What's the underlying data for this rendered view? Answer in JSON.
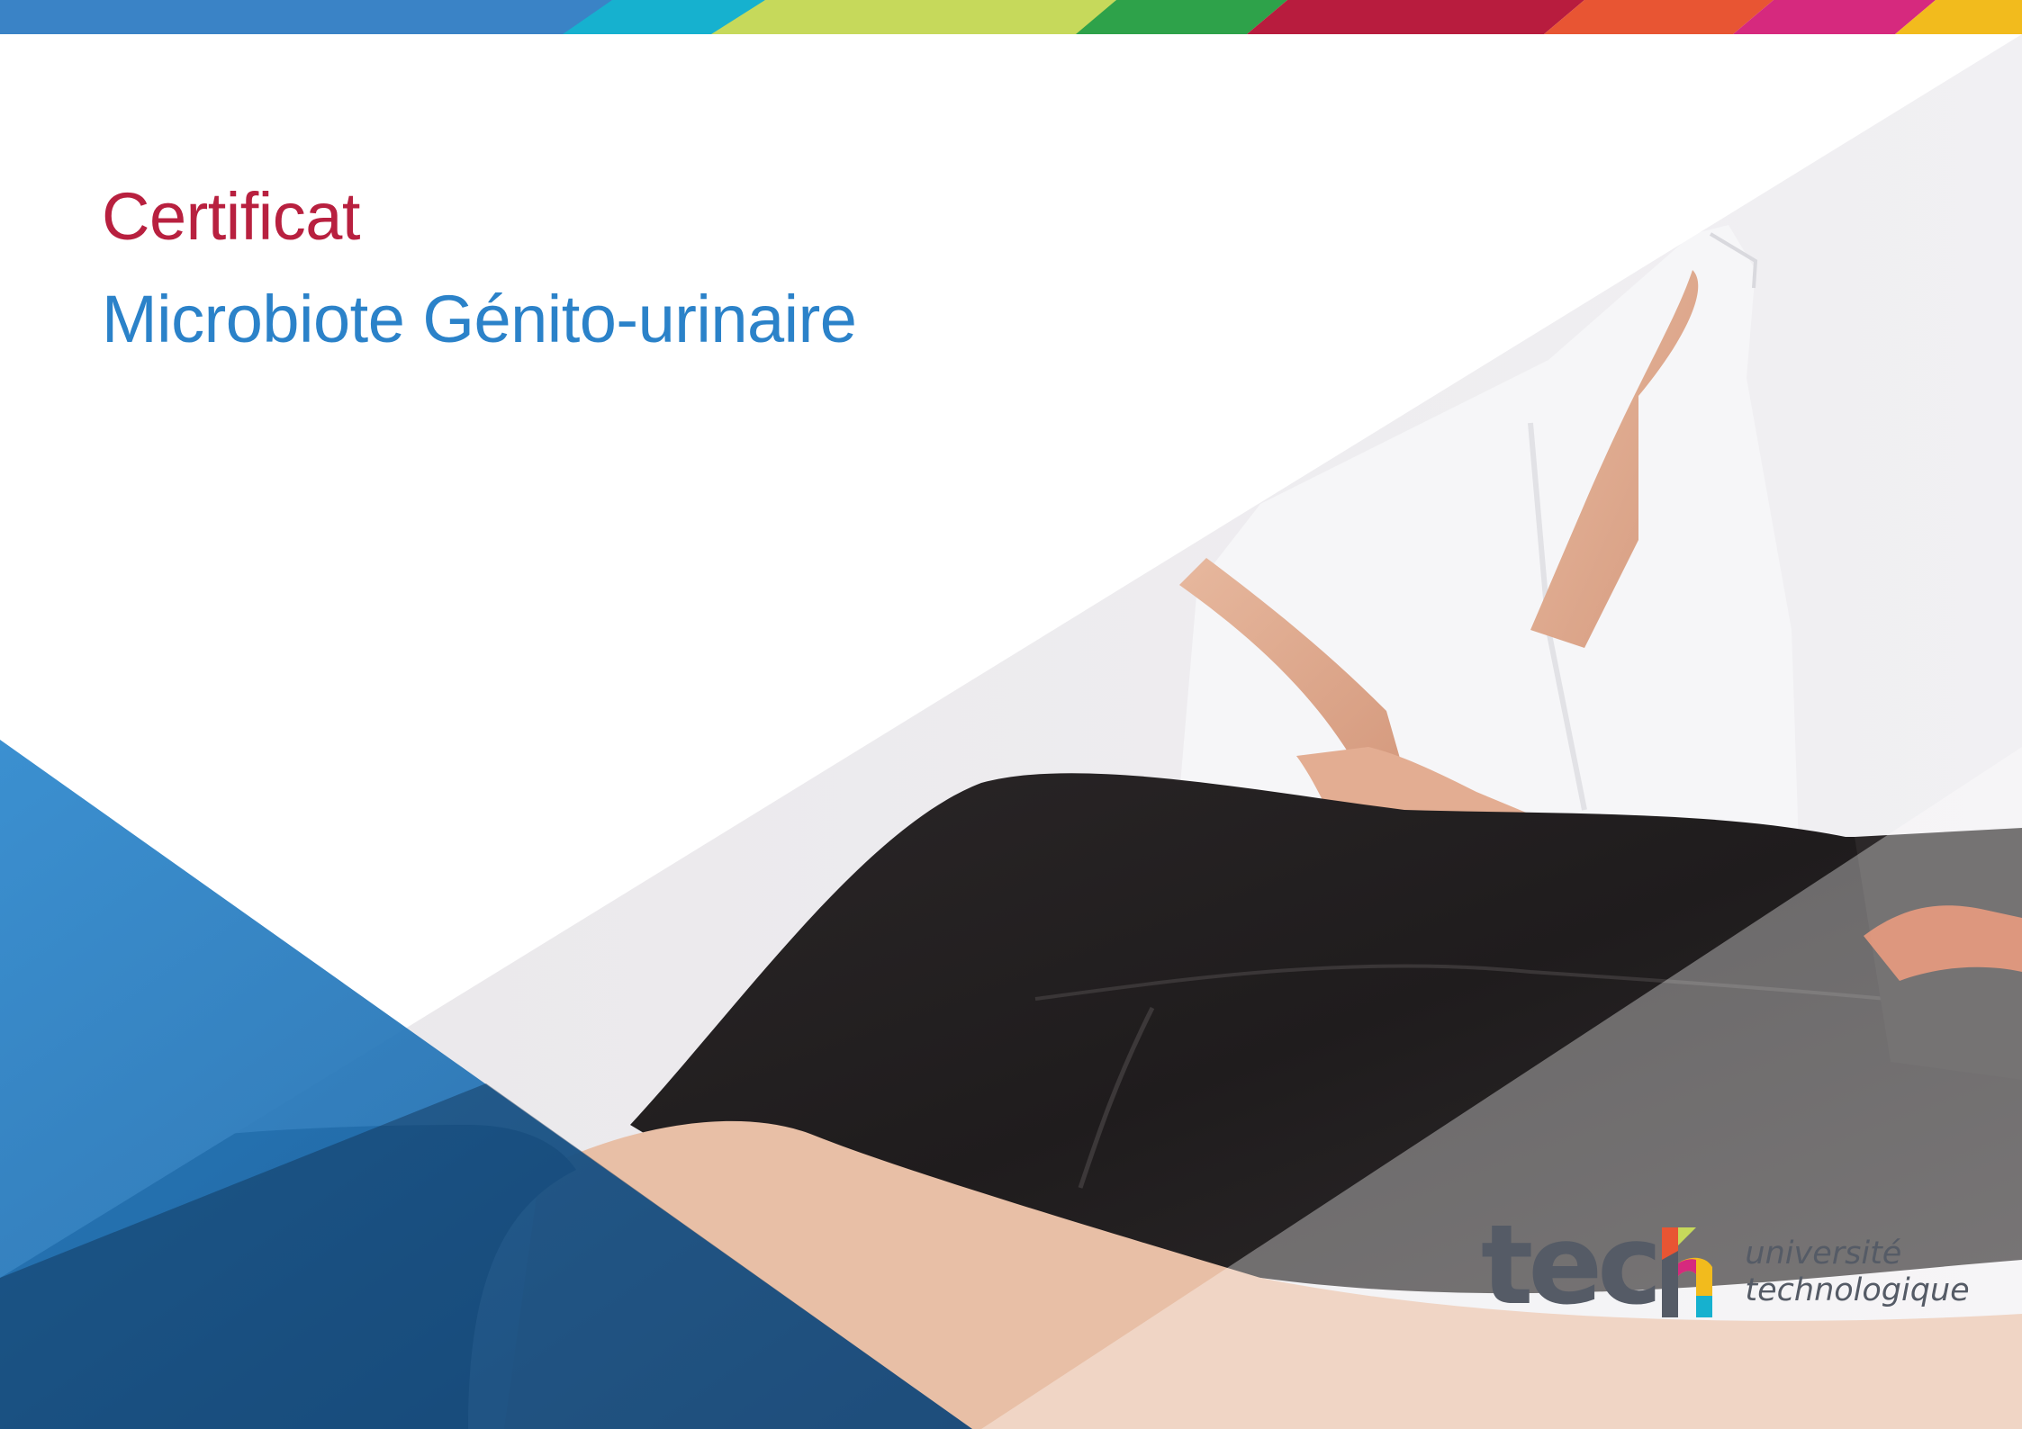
{
  "document": {
    "title": "Certificat",
    "subtitle": "Microbiote Génito-urinaire"
  },
  "brand": {
    "wordmark": "tec",
    "tagline_line1": "université",
    "tagline_line2": "technologique"
  },
  "colors": {
    "title": "#b8203f",
    "subtitle": "#2b82c9",
    "blue_panel": "#2176bd",
    "logo_text": "#555b66",
    "stripe": [
      "#3a83c6",
      "#16b1cf",
      "#c6d95b",
      "#2ea24a",
      "#b81c3e",
      "#e85533",
      "#d6297e",
      "#f2bb1d"
    ]
  },
  "photo": {
    "subject": "therapist pressing on lower back of a patient lying face down in black shorts"
  }
}
